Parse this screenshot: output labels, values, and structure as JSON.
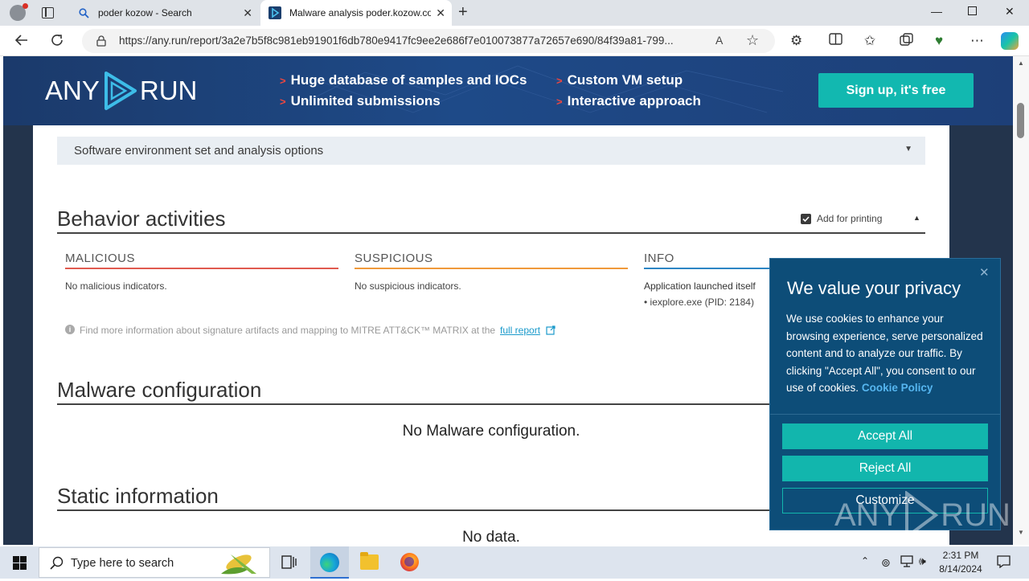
{
  "browser": {
    "tabs": [
      {
        "title": "poder kozow - Search"
      },
      {
        "title": "Malware analysis poder.kozow.co"
      }
    ],
    "url": "https://any.run/report/3a2e7b5f8c981eb91901f6db780e9417fc9ee2e686f7e010073877a72657e690/84f39a81-799..."
  },
  "banner": {
    "logo_left": "ANY",
    "logo_right": "RUN",
    "points": [
      "Huge database of samples and IOCs",
      "Unlimited submissions",
      "Custom VM setup",
      "Interactive approach"
    ],
    "signup": "Sign up, it's free"
  },
  "report": {
    "env_label": "Software environment set and analysis options",
    "behavior_title": "Behavior activities",
    "add_for_printing": "Add for printing",
    "malicious": {
      "title": "MALICIOUS",
      "text": "No malicious indicators."
    },
    "suspicious": {
      "title": "SUSPICIOUS",
      "text": "No suspicious indicators."
    },
    "info": {
      "title": "INFO",
      "text": "Application launched itself",
      "item": "• iexplore.exe (PID: 2184)"
    },
    "mitre_note": "Find more information about signature artifacts and mapping to MITRE ATT&CK™ MATRIX at the",
    "full_report": "full report",
    "malware_title": "Malware configuration",
    "malware_text": "No Malware configuration.",
    "static_title": "Static information",
    "static_text": "No data."
  },
  "cookie": {
    "title": "We value your privacy",
    "body": "We use cookies to enhance your browsing experience, serve personalized content and to analyze our traffic. By clicking \"Accept All\", you consent to our use of cookies.",
    "policy": "Cookie Policy",
    "accept": "Accept All",
    "reject": "Reject All",
    "customize": "Customize",
    "watermark_left": "ANY",
    "watermark_right": "RUN"
  },
  "taskbar": {
    "search_placeholder": "Type here to search",
    "time": "2:31 PM",
    "date": "8/14/2024"
  },
  "colors": {
    "malicious": "#e05a4f",
    "suspicious": "#f0993a",
    "info": "#2d86c4",
    "accent": "#12b6ad"
  }
}
